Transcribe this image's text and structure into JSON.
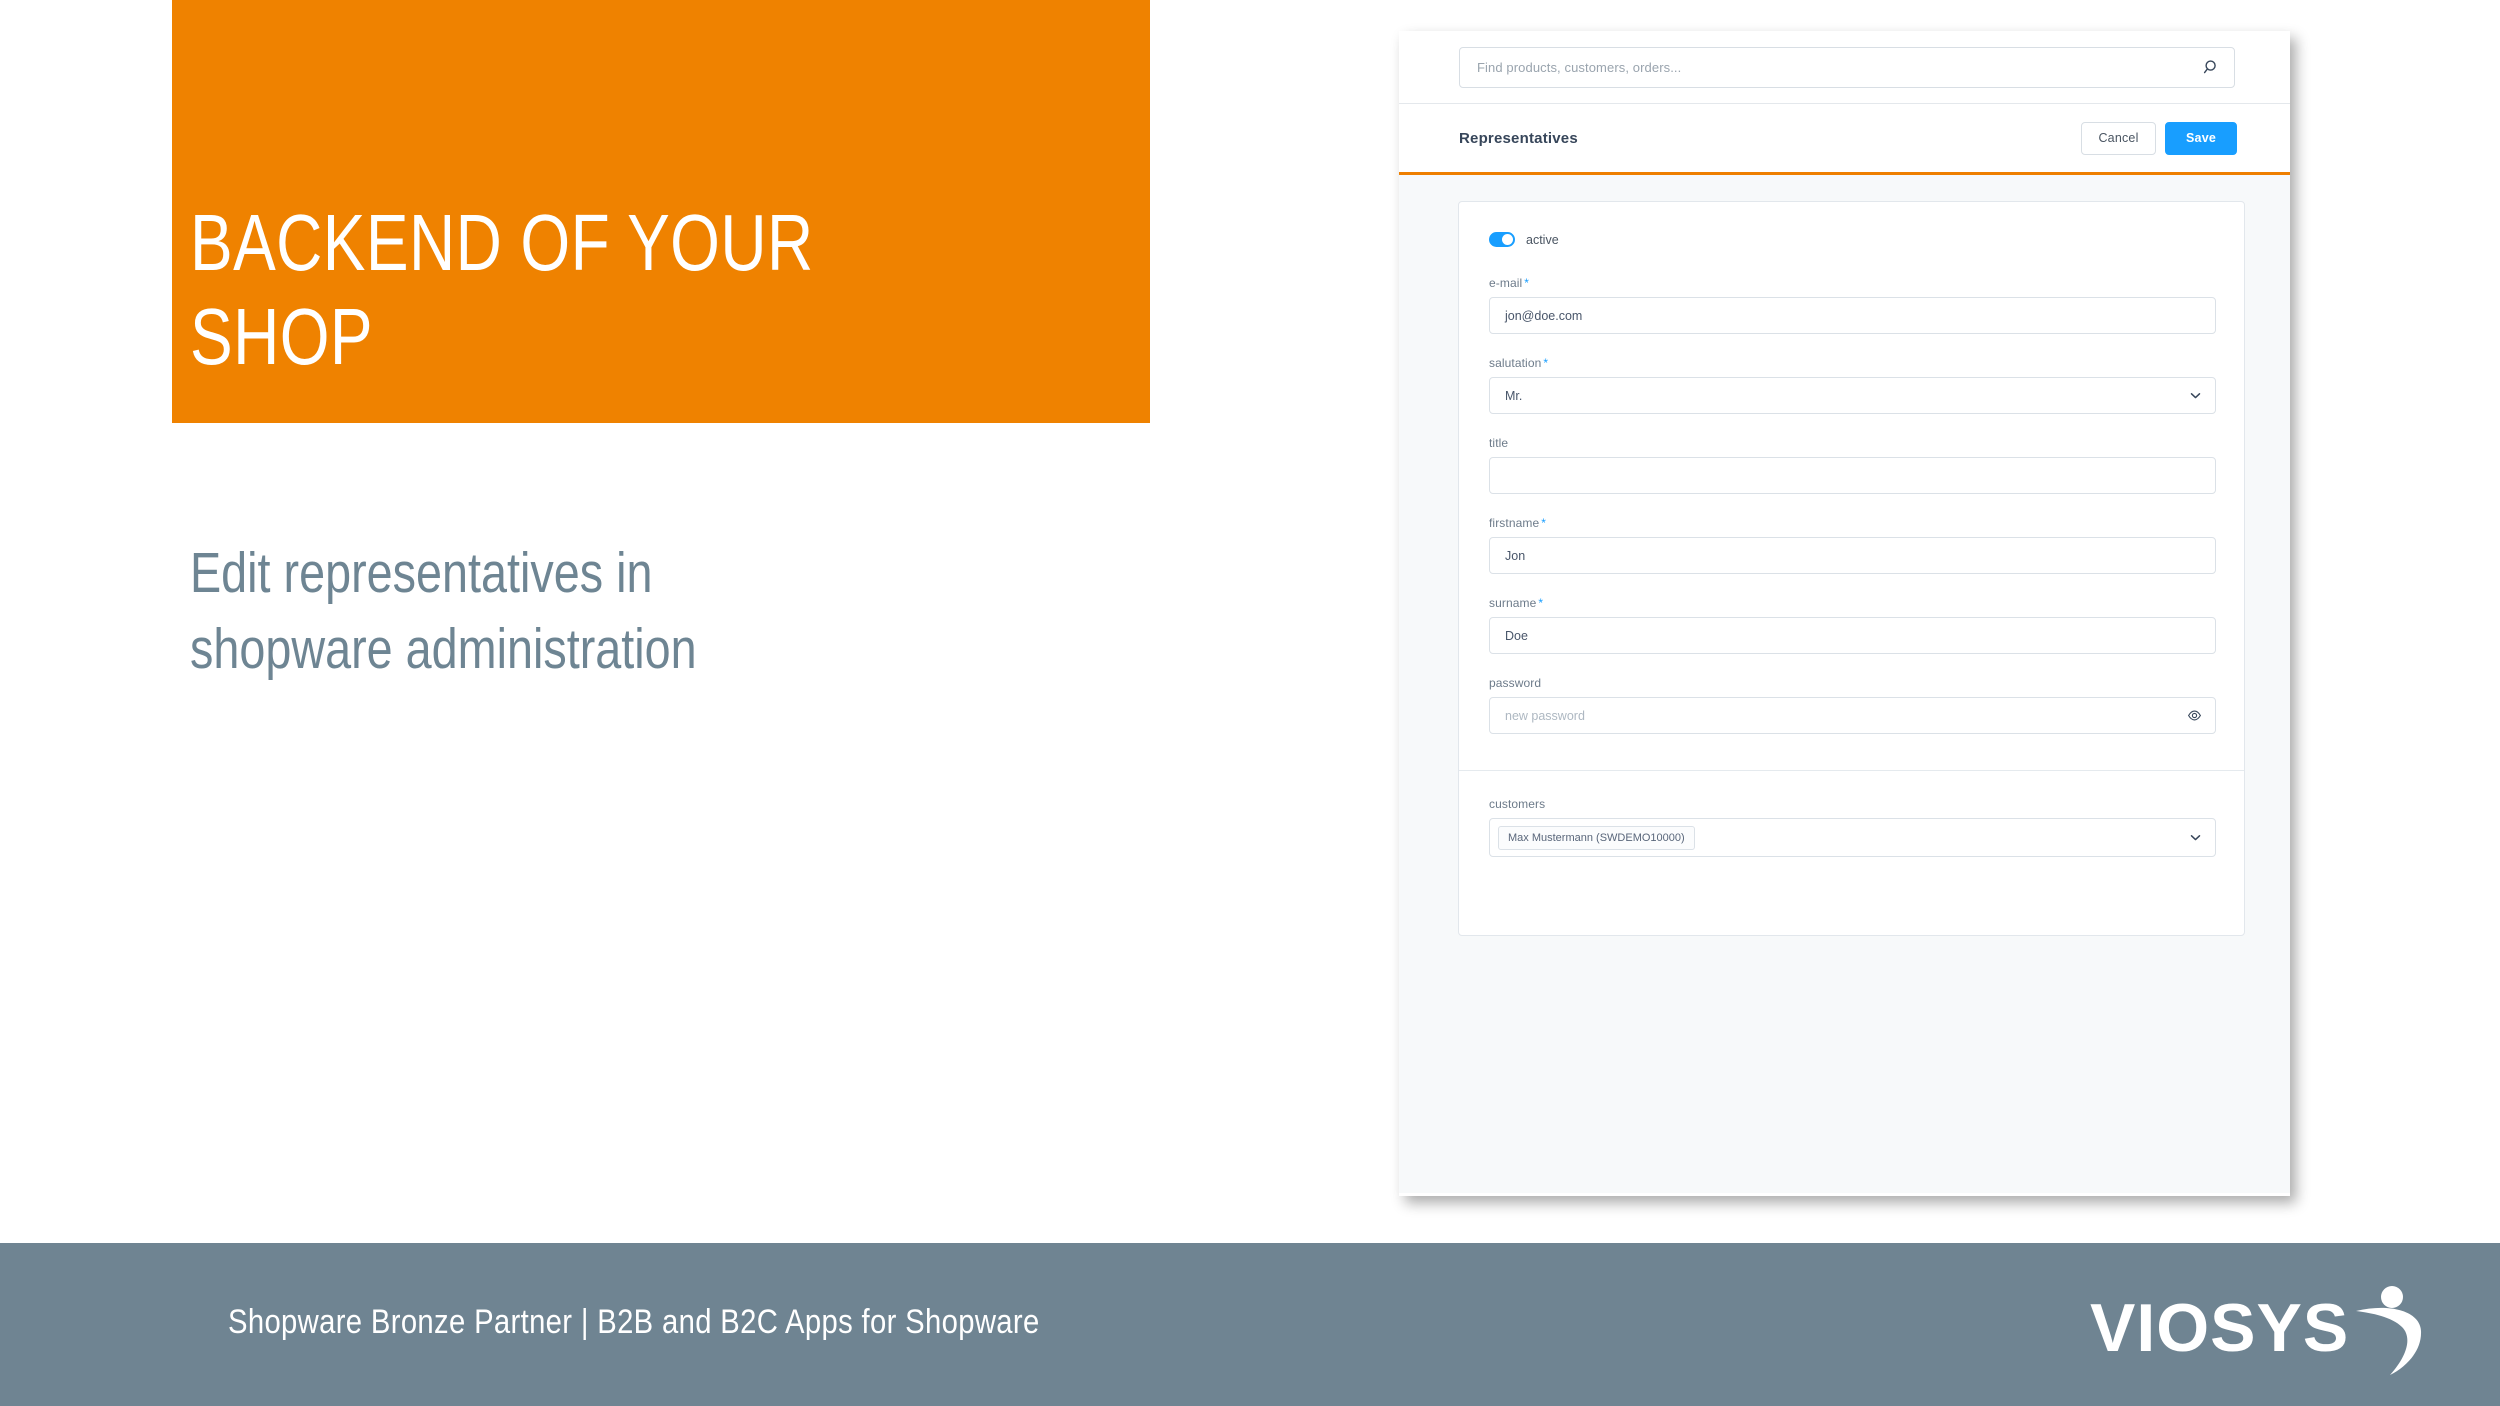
{
  "slide": {
    "title": "BACKEND OF YOUR\nSHOP",
    "subtitle": "Edit representatives in\nshopware administration",
    "accent_color": "#ef8200",
    "subtitle_color": "#6e8593"
  },
  "admin": {
    "search": {
      "placeholder": "Find products, customers, orders...",
      "icon": "search-icon"
    },
    "header": {
      "title": "Representatives",
      "cancel_label": "Cancel",
      "save_label": "Save",
      "save_color": "#189eff",
      "accent_rule_color": "#ee7f00"
    },
    "form": {
      "toggle": {
        "label": "active",
        "state": "on",
        "color": "#189eff"
      },
      "fields": [
        {
          "label": "e-mail",
          "required": "*",
          "type": "text",
          "value": "jon@doe.com",
          "placeholder": ""
        },
        {
          "label": "salutation",
          "required": "*",
          "type": "select",
          "value": "Mr.",
          "icon": "chevron-down-icon"
        },
        {
          "label": "title",
          "required": "",
          "type": "text",
          "value": "",
          "placeholder": ""
        },
        {
          "label": "firstname",
          "required": "*",
          "type": "text",
          "value": "Jon",
          "placeholder": ""
        },
        {
          "label": "surname",
          "required": "*",
          "type": "text",
          "value": "Doe",
          "placeholder": ""
        },
        {
          "label": "password",
          "required": "",
          "type": "password",
          "value": "",
          "placeholder": "new password",
          "icon": "eye-icon"
        }
      ],
      "customers": {
        "label": "customers",
        "chips": [
          "Max Mustermann (SWDEMO10000)"
        ],
        "icon": "chevron-down-icon"
      }
    }
  },
  "footer": {
    "text": "Shopware Bronze Partner  |  B2B and B2C Apps for Shopware",
    "background": "#6f8492",
    "logo_text": "VIOSYS"
  }
}
